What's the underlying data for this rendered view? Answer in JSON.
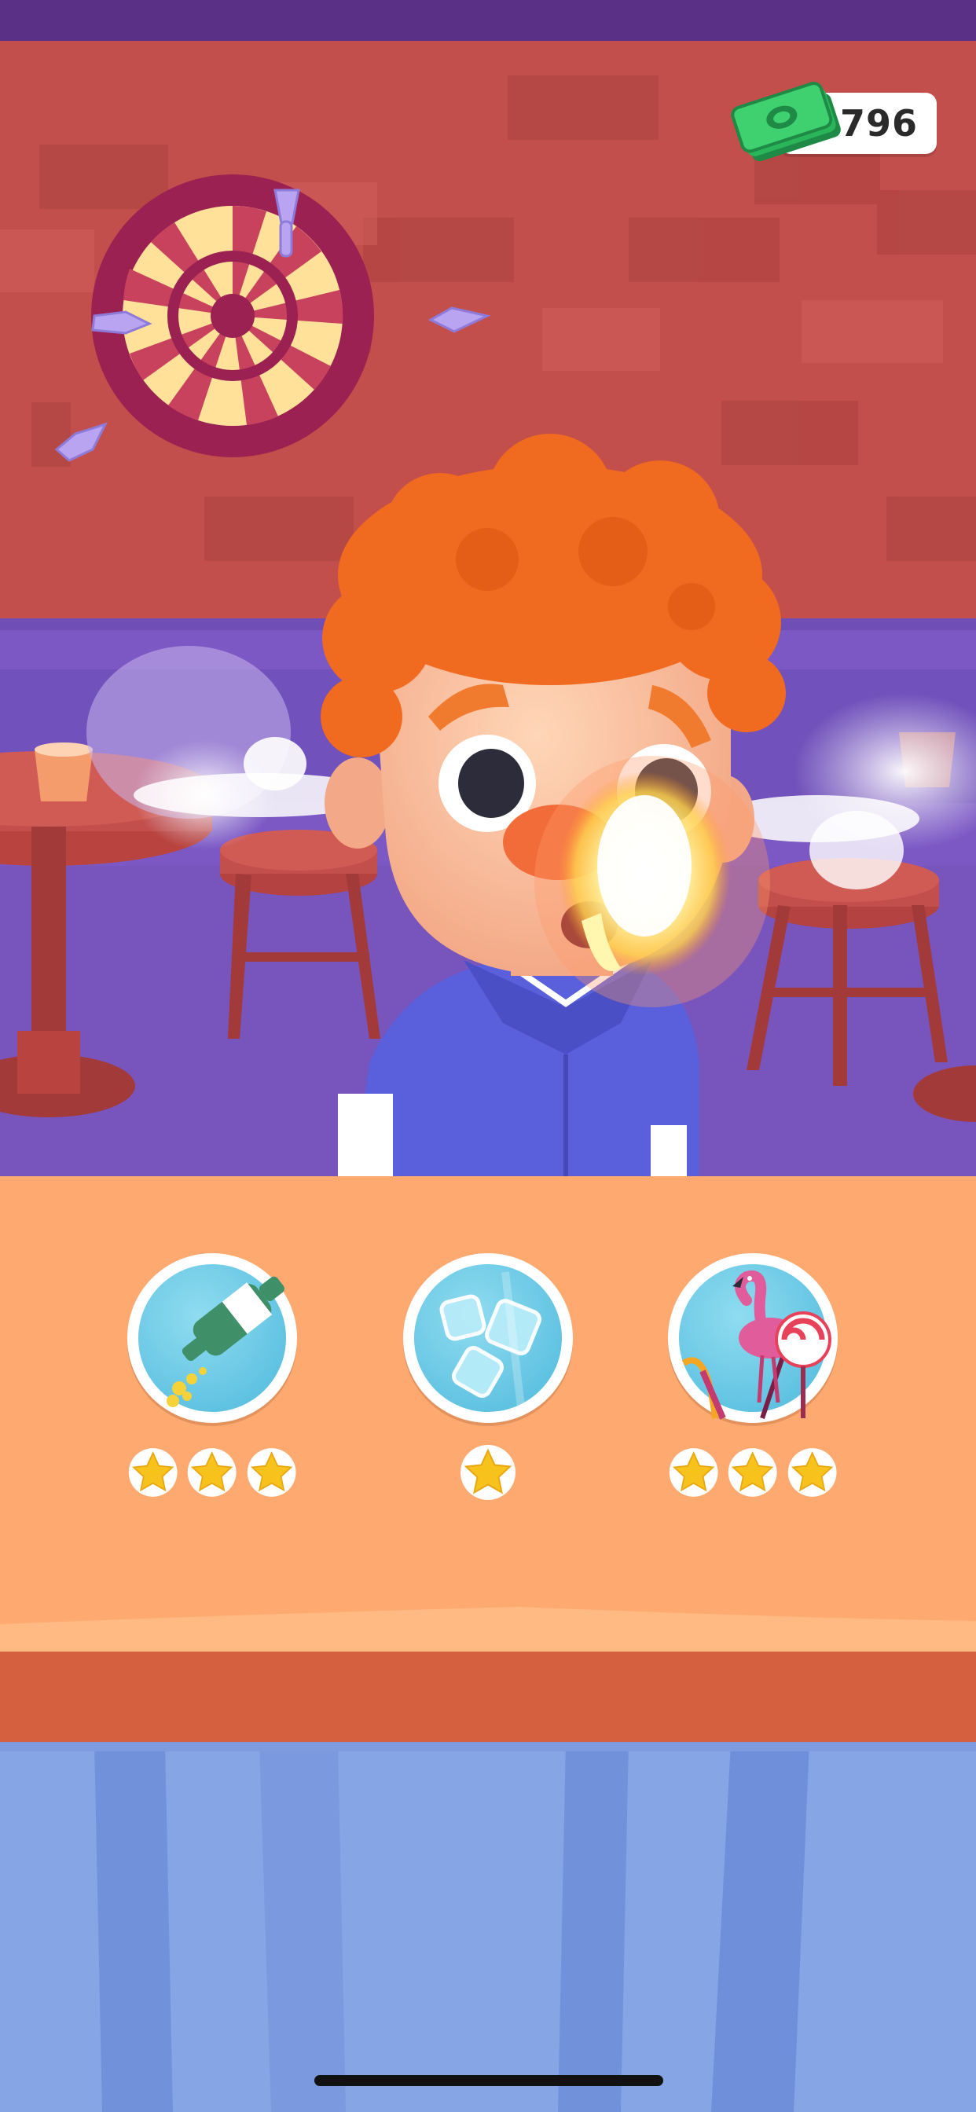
{
  "hud": {
    "money_amount": "796",
    "money_icon": "cash-stack-icon"
  },
  "toppings": [
    {
      "id": "sprinkle",
      "icon": "bottle-sprinkle-icon",
      "stars": 3
    },
    {
      "id": "ice",
      "icon": "ice-cubes-icon",
      "stars": 1
    },
    {
      "id": "decor",
      "icon": "flamingo-lollipop-icon",
      "stars": 3
    }
  ],
  "colors": {
    "wall": "#c24f4c",
    "panel": "#fea96f",
    "counter_edge": "#d4603f",
    "floor": "#86a5e4",
    "hair": "#f06a20",
    "shirt": "#5a5fdc",
    "star": "#f7c21b"
  }
}
